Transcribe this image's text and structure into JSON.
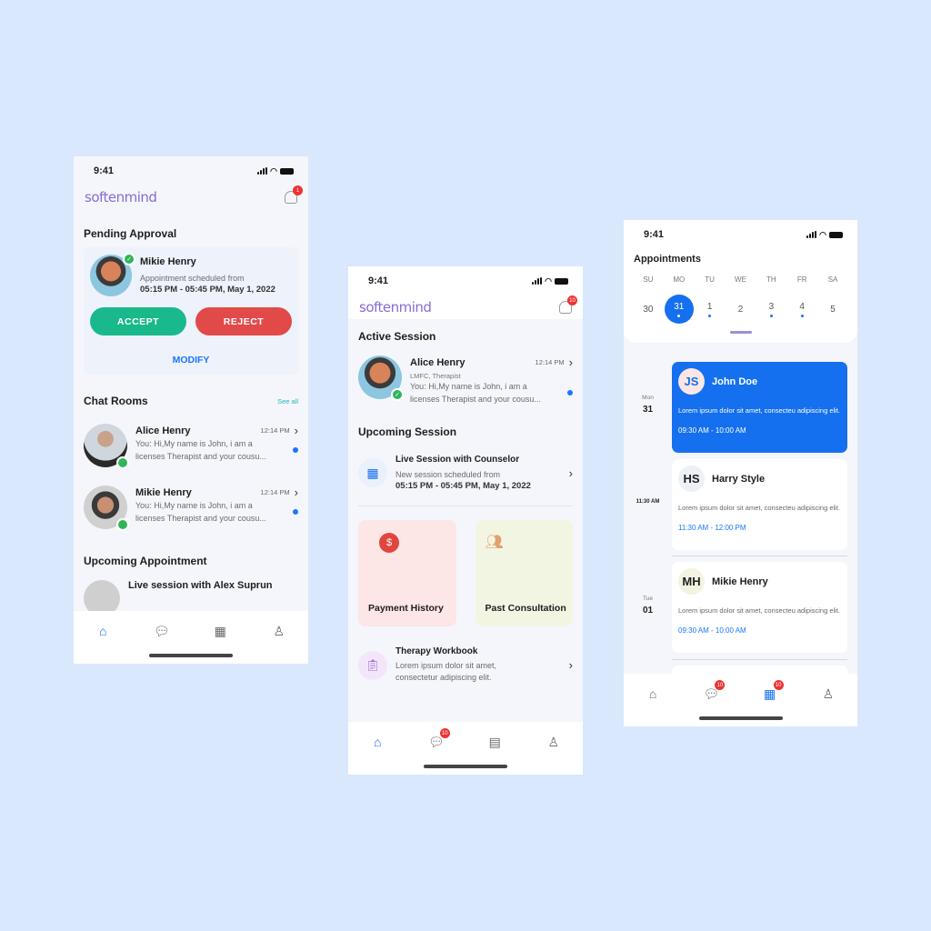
{
  "status_time": "9:41",
  "brand": {
    "logo": "softenmind",
    "accent": "#1570ef",
    "logo_color": "#8a6bd1"
  },
  "screen1": {
    "notification_badge": "1",
    "pending": {
      "title": "Pending Approval",
      "name": "Mikie Henry",
      "line1": "Appointment scheduled from",
      "line2": "05:15 PM - 05:45 PM, May 1, 2022",
      "accept": "ACCEPT",
      "reject": "REJECT",
      "modify": "MODIFY"
    },
    "chat": {
      "title": "Chat Rooms",
      "see_all": "See all",
      "items": [
        {
          "name": "Alice Henry",
          "time": "12:14 PM",
          "msg1": "You: Hi,My name is John, i am a",
          "msg2": "licenses Therapist and your cousu..."
        },
        {
          "name": "Mikie Henry",
          "time": "12:14 PM",
          "msg1": "You: Hi,My name is John, i am a",
          "msg2": "licenses Therapist and your cousu..."
        }
      ]
    },
    "upcoming": {
      "title": "Upcoming Appointment",
      "item": "Live session with Alex Suprun"
    }
  },
  "screen2": {
    "notification_badge": "10",
    "active": {
      "title": "Active Session",
      "name": "Alice Henry",
      "role": "LMFC, Therapist",
      "time": "12:14 PM",
      "msg1": "You: Hi,My name is John, i am a",
      "msg2": "licenses Therapist and your cousu..."
    },
    "upcoming": {
      "title": "Upcoming Session",
      "name": "Live Session with Counselor",
      "line1": "New session scheduled from",
      "line2": "05:15 PM - 05:45 PM, May 1, 2022"
    },
    "tiles": [
      {
        "label": "Payment History"
      },
      {
        "label": "Past Consultation"
      }
    ],
    "workbook": {
      "title": "Therapy Workbook",
      "line1": "Lorem ipsum dolor sit amet,",
      "line2": "consectetur adipiscing elit."
    },
    "chat_badge": "10"
  },
  "screen3": {
    "title": "Appointments",
    "day_names": [
      "SU",
      "MO",
      "TU",
      "WE",
      "TH",
      "FR",
      "SA"
    ],
    "day_nums": [
      "30",
      "31",
      "1",
      "2",
      "3",
      "4",
      "5"
    ],
    "selected_day": "31",
    "marked_days": [
      "31",
      "1",
      "3",
      "4"
    ],
    "labels": {
      "mon": "Mon",
      "mon_num": "31",
      "time": "11:30 AM",
      "tue": "Tue",
      "tue_num": "01"
    },
    "appointments": [
      {
        "initials": "JS",
        "name": "John Doe",
        "desc": "Lorem ipsum dolor sit amet, consecteu adipiscing elit.",
        "time": "09:30 AM - 10:00 AM"
      },
      {
        "initials": "HS",
        "name": "Harry Style",
        "desc": "Lorem ipsum dolor sit amet, consecteu adipiscing elit.",
        "time": "11:30 AM - 12:00 PM"
      },
      {
        "initials": "MH",
        "name": "Mikie Henry",
        "desc": "Lorem ipsum dolor sit amet, consecteu adipiscing elit.",
        "time": "09:30 AM - 10:00 AM"
      }
    ],
    "chat_badge": "10",
    "calendar_badge": "10"
  }
}
